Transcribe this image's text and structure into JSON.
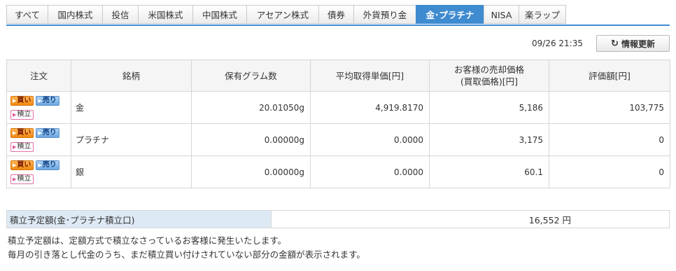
{
  "tabs": [
    {
      "label": "すべて",
      "active": false
    },
    {
      "label": "国内株式",
      "active": false
    },
    {
      "label": "投信",
      "active": false
    },
    {
      "label": "米国株式",
      "active": false
    },
    {
      "label": "中国株式",
      "active": false
    },
    {
      "label": "アセアン株式",
      "active": false
    },
    {
      "label": "債券",
      "active": false
    },
    {
      "label": "外貨預り金",
      "active": false
    },
    {
      "label": "金･プラチナ",
      "active": true
    },
    {
      "label": "NISA",
      "active": false
    },
    {
      "label": "楽ラップ",
      "active": false
    }
  ],
  "timestamp": "09/26 21:35",
  "refresh_label": "情報更新",
  "table": {
    "headers": {
      "order": "注文",
      "name": "銘柄",
      "grams": "保有グラム数",
      "avg_cost": "平均取得単価[円]",
      "sell_price_1": "お客様の売却価格",
      "sell_price_2": "(買取価格)[円]",
      "value": "評価額[円]"
    },
    "order_labels": {
      "buy": "買い",
      "sell": "売り",
      "tsumitate": "積立"
    },
    "rows": [
      {
        "name": "金",
        "grams": "20.01050g",
        "avg_cost": "4,919.8170",
        "sell_price": "5,186",
        "value": "103,775"
      },
      {
        "name": "プラチナ",
        "grams": "0.00000g",
        "avg_cost": "0.0000",
        "sell_price": "3,175",
        "value": "0"
      },
      {
        "name": "銀",
        "grams": "0.00000g",
        "avg_cost": "0.0000",
        "sell_price": "60.1",
        "value": "0"
      }
    ]
  },
  "reserve": {
    "label": "積立予定額(金･プラチナ積立口)",
    "value": "16,552 円"
  },
  "notes": [
    "積立予定額は、定額方式で積立なさっているお客様に発生いたします。",
    "毎月の引き落とし代金のうち、まだ積立買い付けされていない部分の金額が表示されます。"
  ]
}
